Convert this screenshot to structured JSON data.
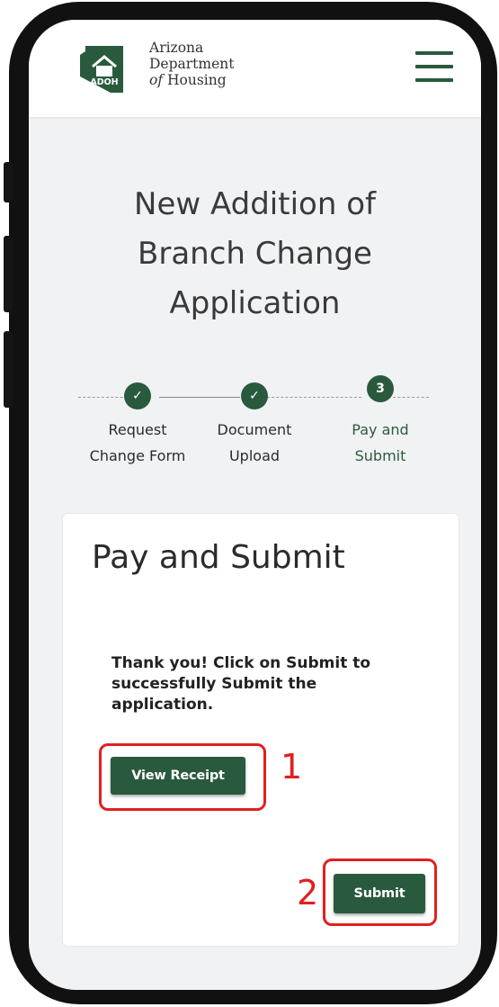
{
  "header": {
    "logo_badge": "ADOH",
    "logo_line1": "Arizona",
    "logo_line2": "Department",
    "logo_line3_italic": "of",
    "logo_line3_rest": " Housing"
  },
  "page": {
    "title_lines": [
      "New Addition of",
      "Branch Change",
      "Application"
    ]
  },
  "stepper": {
    "steps": [
      {
        "icon": "✓",
        "label_lines": [
          "Request",
          "Change Form"
        ],
        "status": "complete"
      },
      {
        "icon": "✓",
        "label_lines": [
          "Document",
          "Upload"
        ],
        "status": "complete"
      },
      {
        "icon": "3",
        "label_lines": [
          "Pay and",
          "Submit"
        ],
        "status": "active"
      }
    ]
  },
  "card": {
    "title": "Pay and Submit",
    "message": "Thank you! Click on Submit to successfully Submit the application.",
    "view_receipt_label": "View Receipt",
    "submit_label": "Submit"
  },
  "annotations": {
    "label_1": "1",
    "label_2": "2",
    "highlight_color": "#e02020"
  },
  "colors": {
    "brand_green": "#2a5a3d",
    "background": "#f1f2f4"
  }
}
